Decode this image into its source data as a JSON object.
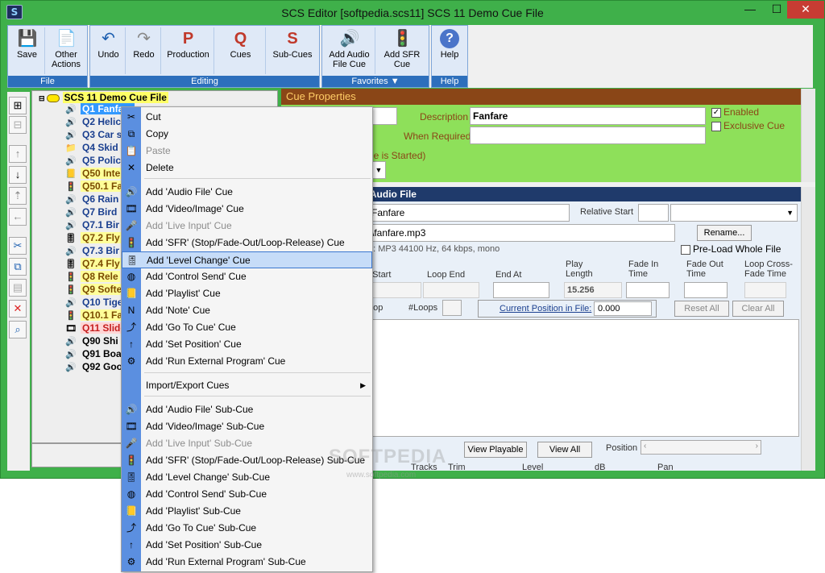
{
  "window": {
    "title": "SCS Editor  [softpedia.scs11]  SCS 11 Demo Cue File",
    "app_icon": "scs-app-icon",
    "minimize": "—",
    "maximize": "☐",
    "close": "✕"
  },
  "ribbon": {
    "groups": [
      {
        "label": "File",
        "buttons": [
          {
            "label": "Save",
            "icon": "save-icon",
            "glyph": "💾",
            "arrow": ""
          },
          {
            "label": "Other Actions",
            "icon": "document-icon",
            "glyph": "📄",
            "arrow": "▼"
          }
        ]
      },
      {
        "label": "Editing",
        "buttons": [
          {
            "label": "Undo",
            "icon": "undo-icon",
            "glyph": "↶",
            "arrow": "▼"
          },
          {
            "label": "Redo",
            "icon": "redo-icon",
            "glyph": "↷",
            "arrow": "▼"
          },
          {
            "label": "Production",
            "icon": "production-icon",
            "glyph": "P",
            "arrow": "▼"
          },
          {
            "label": "Cues",
            "icon": "cues-icon",
            "glyph": "Q",
            "arrow": "▼"
          },
          {
            "label": "Sub-Cues",
            "icon": "subcues-icon",
            "glyph": "S",
            "arrow": "▼"
          }
        ]
      },
      {
        "label": "Favorites ▼",
        "buttons": [
          {
            "label": "Add Audio File Cue",
            "icon": "add-audio-cue-icon",
            "glyph": "🔊",
            "arrow": ""
          },
          {
            "label": "Add SFR Cue",
            "icon": "add-sfr-cue-icon",
            "glyph": "🚦",
            "arrow": ""
          }
        ]
      },
      {
        "label": "Help",
        "buttons": [
          {
            "label": "Help",
            "icon": "help-icon",
            "glyph": "?",
            "arrow": ""
          }
        ]
      }
    ]
  },
  "tree": {
    "root": "SCS 11 Demo Cue File",
    "items": [
      {
        "label": "Q1 Fanfare",
        "icon": "audio-icon",
        "glyph": "🔊",
        "style": "c-sel"
      },
      {
        "label": "Q2 Helic",
        "icon": "audio-icon",
        "glyph": "🔊",
        "style": "c-blue"
      },
      {
        "label": "Q3 Car s",
        "icon": "audio-icon",
        "glyph": "🔊",
        "style": "c-blue"
      },
      {
        "label": "Q4 Skid",
        "icon": "folder-icon",
        "glyph": "📁",
        "style": "c-blue"
      },
      {
        "label": "Q5 Polic",
        "icon": "audio-icon",
        "glyph": "🔊",
        "style": "c-blue"
      },
      {
        "label": "Q50 Inte",
        "icon": "note-icon",
        "glyph": "📒",
        "style": "c-olive"
      },
      {
        "label": "Q50.1 Fa",
        "icon": "sfr-icon",
        "glyph": "🚦",
        "style": "c-olive"
      },
      {
        "label": "Q6 Rain",
        "icon": "audio-icon",
        "glyph": "🔊",
        "style": "c-blue"
      },
      {
        "label": "Q7 Bird",
        "icon": "audio-icon",
        "glyph": "🔊",
        "style": "c-blue"
      },
      {
        "label": "Q7.1 Bir",
        "icon": "audio-icon",
        "glyph": "🔊",
        "style": "c-blue"
      },
      {
        "label": "Q7.2 Fly",
        "icon": "level-icon",
        "glyph": "🎚",
        "style": "c-olive"
      },
      {
        "label": "Q7.3 Bir",
        "icon": "audio-icon",
        "glyph": "🔊",
        "style": "c-blue"
      },
      {
        "label": "Q7.4 Fly",
        "icon": "level-icon",
        "glyph": "🎚",
        "style": "c-olive"
      },
      {
        "label": "Q8 Rele",
        "icon": "sfr-icon",
        "glyph": "🚦",
        "style": "c-olive"
      },
      {
        "label": "Q9 Softe",
        "icon": "sfr-icon",
        "glyph": "🚦",
        "style": "c-olive"
      },
      {
        "label": "Q10 Tige",
        "icon": "audio-icon",
        "glyph": "🔊",
        "style": "c-blue"
      },
      {
        "label": "Q10.1 Fa",
        "icon": "sfr-icon",
        "glyph": "🚦",
        "style": "c-olive"
      },
      {
        "label": "Q11 Slide",
        "icon": "video-icon",
        "glyph": "🎞",
        "style": "c-red"
      },
      {
        "label": "Q90 Shi",
        "icon": "audio-icon",
        "glyph": "🔊",
        "style": "c-black"
      },
      {
        "label": "Q91 Boa",
        "icon": "audio-icon",
        "glyph": "🔊",
        "style": "c-black"
      },
      {
        "label": "Q92 Goo",
        "icon": "audio-icon",
        "glyph": "🔊",
        "style": "c-black"
      }
    ]
  },
  "cue_properties": {
    "header": "Cue Properties",
    "description_label": "Description",
    "description_value": "Fanfare",
    "when_required_label": "When Required",
    "enabled_label": "Enabled",
    "exclusive_label": "Exclusive Cue",
    "started_fragment": "ue is Started)"
  },
  "subcue": {
    "header": ": Audio File",
    "name_value": "Fanfare",
    "relative_start_label": "Relative Start",
    "file_value": "\\fanfare.mp3",
    "rename_label": "Rename...",
    "format_text": "e: MP3 44100 Hz, 64 kbps, mono",
    "preload_label": "Pre-Load Whole File",
    "col_loop_start": "p Start",
    "col_loop_end": "Loop End",
    "col_end_at": "End At",
    "col_play_length": "Play Length",
    "col_fade_in": "Fade In Time",
    "col_fade_out": "Fade Out Time",
    "col_loop_cross": "Loop Cross-Fade Time",
    "play_length_value": "15.256",
    "loop_fragment": "oop",
    "loops_label": "#Loops",
    "current_position_label": "Current Position in File:",
    "current_position_value": "0.000",
    "reset_all": "Reset All",
    "clear_all": "Clear All",
    "view_playable": "View Playable",
    "view_all": "View All",
    "position_label": "Position",
    "col_tracks": "Tracks",
    "col_trim": "Trim",
    "col_level": "Level",
    "col_db": "dB",
    "col_pan": "Pan"
  },
  "context_menu": {
    "items": [
      {
        "label": "Cut",
        "icon": "scissors-icon",
        "glyph": "✂",
        "disabled": false,
        "highlight": false
      },
      {
        "label": "Copy",
        "icon": "copy-icon",
        "glyph": "⧉",
        "disabled": false,
        "highlight": false
      },
      {
        "label": "Paste",
        "icon": "paste-icon",
        "glyph": "📋",
        "disabled": true,
        "highlight": false
      },
      {
        "label": "Delete",
        "icon": "delete-icon",
        "glyph": "✕",
        "disabled": false,
        "highlight": false
      },
      {
        "label": "Add 'Audio File' Cue",
        "icon": "audio-icon",
        "glyph": "🔊",
        "disabled": false,
        "highlight": false
      },
      {
        "label": "Add 'Video/Image' Cue",
        "icon": "video-icon",
        "glyph": "🎞",
        "disabled": false,
        "highlight": false
      },
      {
        "label": "Add 'Live Input' Cue",
        "icon": "microphone-icon",
        "glyph": "🎤",
        "disabled": true,
        "highlight": false
      },
      {
        "label": "Add 'SFR' (Stop/Fade-Out/Loop-Release) Cue",
        "icon": "sfr-icon",
        "glyph": "🚦",
        "disabled": false,
        "highlight": false
      },
      {
        "label": "Add 'Level Change' Cue",
        "icon": "level-icon",
        "glyph": "🎚",
        "disabled": false,
        "highlight": true
      },
      {
        "label": "Add 'Control Send' Cue",
        "icon": "control-send-icon",
        "glyph": "◍",
        "disabled": false,
        "highlight": false
      },
      {
        "label": "Add 'Playlist' Cue",
        "icon": "playlist-icon",
        "glyph": "📒",
        "disabled": false,
        "highlight": false
      },
      {
        "label": "Add 'Note' Cue",
        "icon": "note-icon",
        "glyph": "N",
        "disabled": false,
        "highlight": false
      },
      {
        "label": "Add 'Go To Cue' Cue",
        "icon": "goto-icon",
        "glyph": "⤴",
        "disabled": false,
        "highlight": false
      },
      {
        "label": "Add 'Set Position' Cue",
        "icon": "set-position-icon",
        "glyph": "↑",
        "disabled": false,
        "highlight": false
      },
      {
        "label": "Add 'Run External Program' Cue",
        "icon": "gear-icon",
        "glyph": "⚙",
        "disabled": false,
        "highlight": false
      },
      {
        "label": "Import/Export Cues",
        "icon": "",
        "glyph": "",
        "disabled": false,
        "highlight": false,
        "submenu": "▶"
      },
      {
        "label": "Add 'Audio File' Sub-Cue",
        "icon": "audio-icon",
        "glyph": "🔊",
        "disabled": false,
        "highlight": false
      },
      {
        "label": "Add 'Video/Image' Sub-Cue",
        "icon": "video-icon",
        "glyph": "🎞",
        "disabled": false,
        "highlight": false
      },
      {
        "label": "Add 'Live Input' Sub-Cue",
        "icon": "microphone-icon",
        "glyph": "🎤",
        "disabled": true,
        "highlight": false
      },
      {
        "label": "Add 'SFR' (Stop/Fade-Out/Loop-Release) Sub-Cue",
        "icon": "sfr-icon",
        "glyph": "🚦",
        "disabled": false,
        "highlight": false
      },
      {
        "label": "Add 'Level Change' Sub-Cue",
        "icon": "level-icon",
        "glyph": "🎚",
        "disabled": false,
        "highlight": false
      },
      {
        "label": "Add 'Control Send' Sub-Cue",
        "icon": "control-send-icon",
        "glyph": "◍",
        "disabled": false,
        "highlight": false
      },
      {
        "label": "Add 'Playlist' Sub-Cue",
        "icon": "playlist-icon",
        "glyph": "📒",
        "disabled": false,
        "highlight": false
      },
      {
        "label": "Add 'Go To Cue' Sub-Cue",
        "icon": "goto-icon",
        "glyph": "⤴",
        "disabled": false,
        "highlight": false
      },
      {
        "label": "Add 'Set Position' Sub-Cue",
        "icon": "set-position-icon",
        "glyph": "↑",
        "disabled": false,
        "highlight": false
      },
      {
        "label": "Add 'Run External Program' Sub-Cue",
        "icon": "gear-icon",
        "glyph": "⚙",
        "disabled": false,
        "highlight": false
      }
    ]
  },
  "watermark": "SOFTPEDIA",
  "watermark_url": "www.softpedia.com"
}
